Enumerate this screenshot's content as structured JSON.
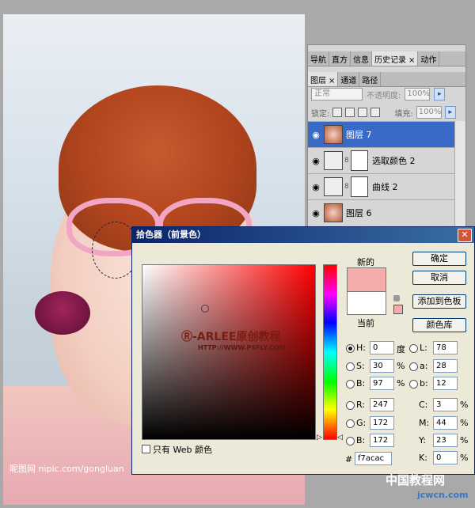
{
  "panel": {
    "tabs_top": [
      {
        "label": "导航"
      },
      {
        "label": "直方"
      },
      {
        "label": "信息"
      },
      {
        "label": "历史记录",
        "close": "×"
      },
      {
        "label": "动作"
      }
    ],
    "tabs_layers": [
      {
        "label": "图层",
        "close": "×"
      },
      {
        "label": "通道"
      },
      {
        "label": "路径"
      }
    ],
    "blend_mode": "正常",
    "opacity_label": "不透明度:",
    "opacity_value": "100%",
    "lock_label": "锁定:",
    "fill_label": "填充:",
    "fill_value": "100%",
    "layers": [
      {
        "name": "图层 7",
        "selected": true
      },
      {
        "name": "选取颜色 2"
      },
      {
        "name": "曲线 2"
      },
      {
        "name": "图层 6"
      }
    ]
  },
  "dialog": {
    "title": "拾色器（前景色）",
    "new_label": "新的",
    "current_label": "当前",
    "buttons": {
      "ok": "确定",
      "cancel": "取消",
      "add_swatch": "添加到色板",
      "libraries": "颜色库"
    },
    "fields": {
      "H": {
        "label": "H:",
        "value": "0",
        "unit": "度"
      },
      "S": {
        "label": "S:",
        "value": "30",
        "unit": "%"
      },
      "B": {
        "label": "B:",
        "value": "97",
        "unit": "%"
      },
      "R": {
        "label": "R:",
        "value": "247"
      },
      "G": {
        "label": "G:",
        "value": "172"
      },
      "Bb": {
        "label": "B:",
        "value": "172"
      },
      "L": {
        "label": "L:",
        "value": "78"
      },
      "a": {
        "label": "a:",
        "value": "28"
      },
      "b": {
        "label": "b:",
        "value": "12"
      },
      "C": {
        "label": "C:",
        "value": "3",
        "unit": "%"
      },
      "M": {
        "label": "M:",
        "value": "44",
        "unit": "%"
      },
      "Y": {
        "label": "Y:",
        "value": "23",
        "unit": "%"
      },
      "K": {
        "label": "K:",
        "value": "0",
        "unit": "%"
      },
      "hex": {
        "label": "#",
        "value": "f7acac"
      }
    },
    "web_only_label": "只有 Web 颜色",
    "logo_text": "Ⓡ-ARLEE原创教程",
    "logo_sub": "HTTP://WWW.PSFLY.COM",
    "new_color": "#f7acac",
    "current_color": "#ffffff"
  },
  "watermarks": {
    "photo": "昵图网 nipic.com/gongluan",
    "site_cn": "中国教程网",
    "site_url": "jcwcn.com"
  }
}
